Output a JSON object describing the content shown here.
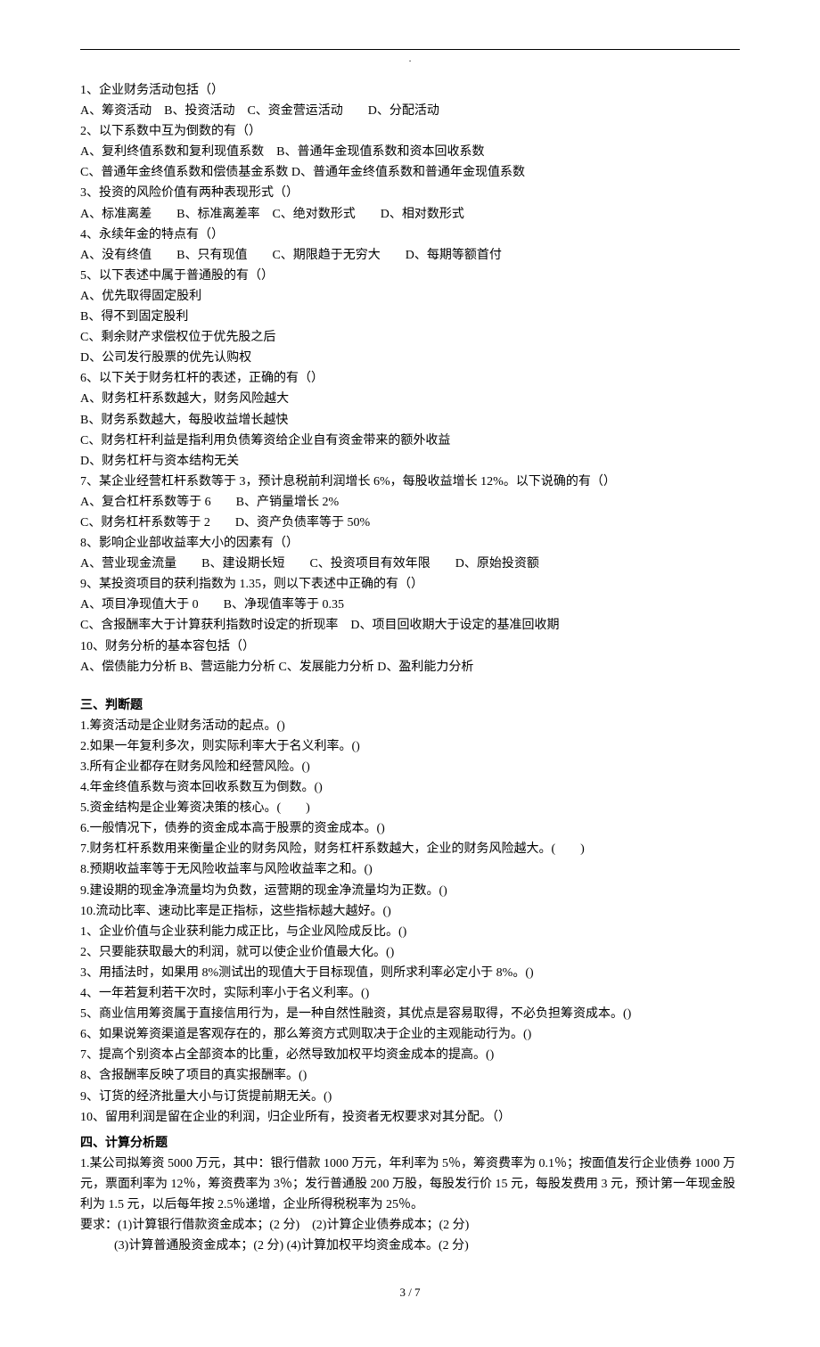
{
  "header_dot": "·",
  "multi_choice": [
    "1、企业财务活动包括（）",
    "A、筹资活动　B、投资活动　C、资金营运活动　　D、分配活动",
    "2、以下系数中互为倒数的有（）",
    "A、复利终值系数和复利现值系数　B、普通年金现值系数和资本回收系数",
    "C、普通年金终值系数和偿债基金系数 D、普通年金终值系数和普通年金现值系数",
    "3、投资的风险价值有两种表现形式（）",
    "A、标准离差　　B、标准离差率　C、绝对数形式　　D、相对数形式",
    "4、永续年金的特点有（）",
    "A、没有终值　　B、只有现值　　C、期限趋于无穷大　　D、每期等额首付",
    "5、以下表述中属于普通股的有（）",
    "A、优先取得固定股利",
    "B、得不到固定股利",
    "C、剩余财产求偿权位于优先股之后",
    "D、公司发行股票的优先认购权",
    "6、以下关于财务杠杆的表述，正确的有（）",
    "A、财务杠杆系数越大，财务风险越大",
    "B、财务系数越大，每股收益增长越快",
    "C、财务杠杆利益是指利用负债筹资给企业自有资金带来的额外收益",
    "D、财务杠杆与资本结构无关",
    "7、某企业经营杠杆系数等于 3，预计息税前利润增长 6%，每股收益增长 12%。以下说确的有（）",
    "A、复合杠杆系数等于 6　　B、产销量增长 2%",
    "C、财务杠杆系数等于 2　　D、资产负债率等于 50%",
    "8、影响企业部收益率大小的因素有（）",
    "A、营业现金流量　　B、建设期长短　　C、投资项目有效年限　　D、原始投资额",
    "9、某投资项目的获利指数为 1.35，则以下表述中正确的有（）",
    "A、项目净现值大于 0　　B、净现值率等于 0.35",
    "C、含报酬率大于计算获利指数时设定的折现率　D、项目回收期大于设定的基准回收期",
    "10、财务分析的基本容包括（）",
    "A、偿债能力分析 B、营运能力分析 C、发展能力分析 D、盈利能力分析"
  ],
  "section_tf": "三、判断题",
  "tf": [
    "1.筹资活动是企业财务活动的起点。()",
    "2.如果一年复利多次，则实际利率大于名义利率。()",
    "3.所有企业都存在财务风险和经营风险。()",
    "4.年金终值系数与资本回收系数互为倒数。()",
    "5.资金结构是企业筹资决策的核心。(　　)",
    "6.一般情况下，债券的资金成本高于股票的资金成本。()",
    "7.财务杠杆系数用来衡量企业的财务风险，财务杠杆系数越大，企业的财务风险越大。(　　)",
    "8.预期收益率等于无风险收益率与风险收益率之和。()",
    "9.建设期的现金净流量均为负数，运营期的现金净流量均为正数。()",
    "10.流动比率、速动比率是正指标，这些指标越大越好。()",
    "1、企业价值与企业获利能力成正比，与企业风险成反比。()",
    "2、只要能获取最大的利润，就可以使企业价值最大化。()",
    "3、用插法时，如果用 8%测试出的现值大于目标现值，则所求利率必定小于 8%。()",
    "4、一年若复利若干次时，实际利率小于名义利率。()",
    "5、商业信用筹资属于直接信用行为，是一种自然性融资，其优点是容易取得，不必负担筹资成本。()",
    "6、如果说筹资渠道是客观存在的，那么筹资方式则取决于企业的主观能动行为。()",
    "7、提高个别资本占全部资本的比重，必然导致加权平均资金成本的提高。()",
    "8、含报酬率反映了项目的真实报酬率。()",
    "9、订货的经济批量大小与订货提前期无关。()",
    "10、留用利润是留在企业的利润，归企业所有，投资者无权要求对其分配。（）"
  ],
  "section_calc": "四、计算分析题",
  "calc": [
    "1.某公司拟筹资 5000 万元，其中：银行借款 1000 万元，年利率为 5％，筹资费率为 0.1％；按面值发行企业债券 1000 万元，票面利率为 12％，筹资费率为 3％；发行普通股 200 万股，每股发行价 15 元，每股发费用 3 元，预计第一年现金股利为 1.5 元，以后每年按 2.5％递增，企业所得税税率为 25％。",
    "要求：(1)计算银行借款资金成本；(2 分)　(2)计算企业债券成本；(2 分)"
  ],
  "calc_indent": "(3)计算普通股资金成本；(2 分) (4)计算加权平均资金成本。(2 分)",
  "page_number": "3 / 7"
}
